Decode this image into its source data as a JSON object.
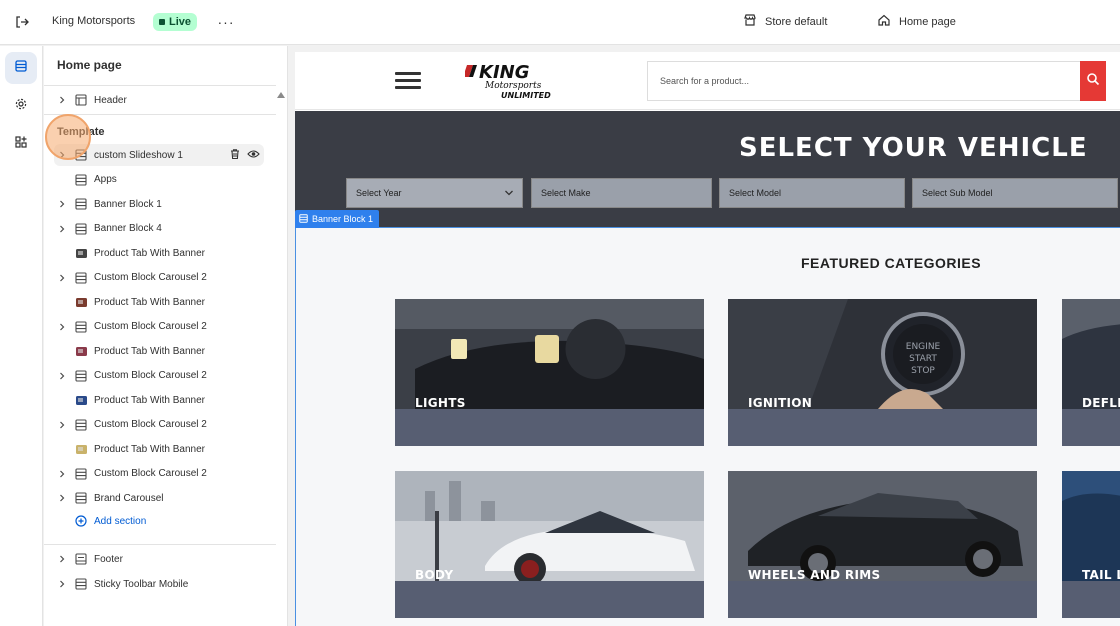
{
  "topbar": {
    "store_name": "King Motorsports",
    "live_badge": "Live",
    "more_label": "···",
    "theme_label": "Store default",
    "page_label": "Home page"
  },
  "sidebar": {
    "title": "Home page",
    "header_item": "Header",
    "template_heading": "Template",
    "template_items": [
      {
        "label": "custom Slideshow 1",
        "icon": "section-icon",
        "expandable": true,
        "selected": true
      },
      {
        "label": "Apps",
        "icon": "section-icon",
        "expandable": false
      },
      {
        "label": "Banner Block 1",
        "icon": "section-icon",
        "expandable": true
      },
      {
        "label": "Banner Block 4",
        "icon": "section-icon",
        "expandable": true
      },
      {
        "label": "Product Tab With Banner",
        "icon": "thumbnail-icon",
        "expandable": false
      },
      {
        "label": "Custom Block Carousel 2",
        "icon": "section-icon",
        "expandable": true
      },
      {
        "label": "Product Tab With Banner",
        "icon": "thumbnail-icon",
        "expandable": false
      },
      {
        "label": "Custom Block Carousel 2",
        "icon": "section-icon",
        "expandable": true
      },
      {
        "label": "Product Tab With Banner",
        "icon": "thumbnail-icon",
        "expandable": false
      },
      {
        "label": "Custom Block Carousel 2",
        "icon": "section-icon",
        "expandable": true
      },
      {
        "label": "Product Tab With Banner",
        "icon": "thumbnail-icon",
        "expandable": false
      },
      {
        "label": "Custom Block Carousel 2",
        "icon": "section-icon",
        "expandable": true
      },
      {
        "label": "Product Tab With Banner",
        "icon": "thumbnail-icon",
        "expandable": false
      },
      {
        "label": "Custom Block Carousel 2",
        "icon": "section-icon",
        "expandable": true
      },
      {
        "label": "Brand Carousel",
        "icon": "section-icon",
        "expandable": true
      }
    ],
    "add_section": "Add section",
    "footer_items": [
      {
        "label": "Footer"
      },
      {
        "label": "Sticky Toolbar Mobile"
      }
    ]
  },
  "preview": {
    "search_placeholder": "Search for a product...",
    "vehicle_title": "SELECT YOUR VEHICLE",
    "selects": [
      "Select Year",
      "Select Make",
      "Select Model",
      "Select Sub Model"
    ],
    "block_tag": "Banner Block 1",
    "featured_title": "FEATURED CATEGORIES",
    "categories": [
      "LIGHTS",
      "IGNITION",
      "DEFLE",
      "BODY",
      "WHEELS AND RIMS",
      "TAIL L"
    ],
    "logo_text": [
      "KING",
      "Motorsports",
      "UNLIMITED"
    ]
  },
  "colors": {
    "accent": "#005bd3",
    "live_bg": "#b4fed2",
    "search_button": "#e53935",
    "card_bg": "#575e72",
    "vehicle_bg": "#3a3d45",
    "selection_outline": "#2f80ed"
  }
}
